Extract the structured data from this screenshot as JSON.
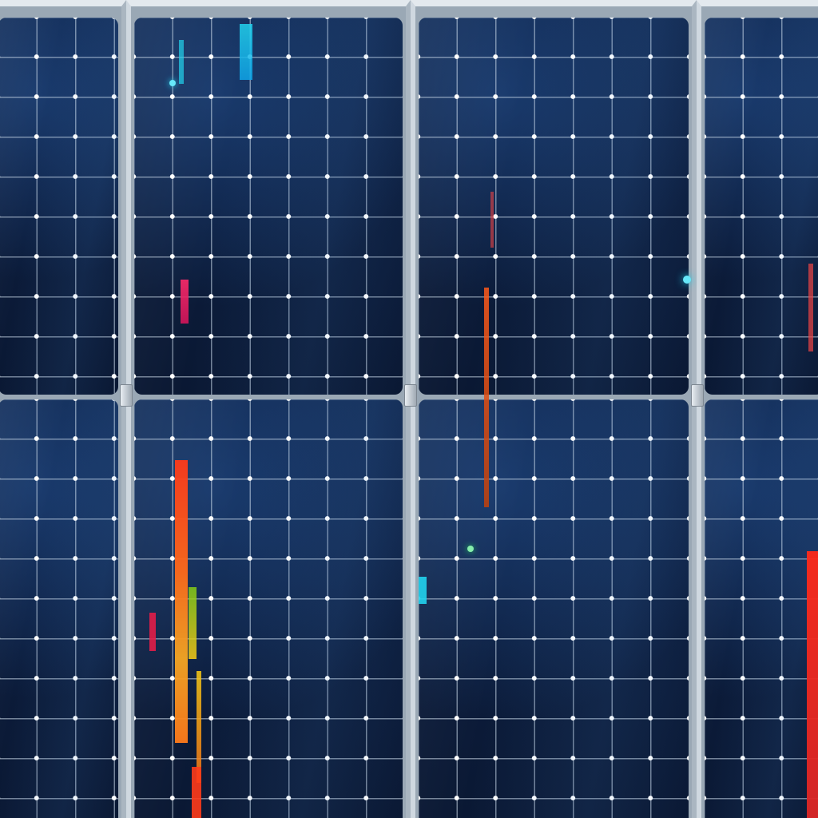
{
  "scene": {
    "subject": "solar-panel-array",
    "panel_count": 4,
    "colors": {
      "cell_dark": "#0a1833",
      "cell_mid": "#10254a",
      "frame": "#cfd8e0",
      "grid_line": "#cddceb",
      "node": "#ffffff",
      "glitch_red": "#ff2a1a",
      "glitch_orange": "#ff7a1a",
      "glitch_cyan": "#22d3ee",
      "glitch_yellow": "#f4d03f"
    }
  }
}
